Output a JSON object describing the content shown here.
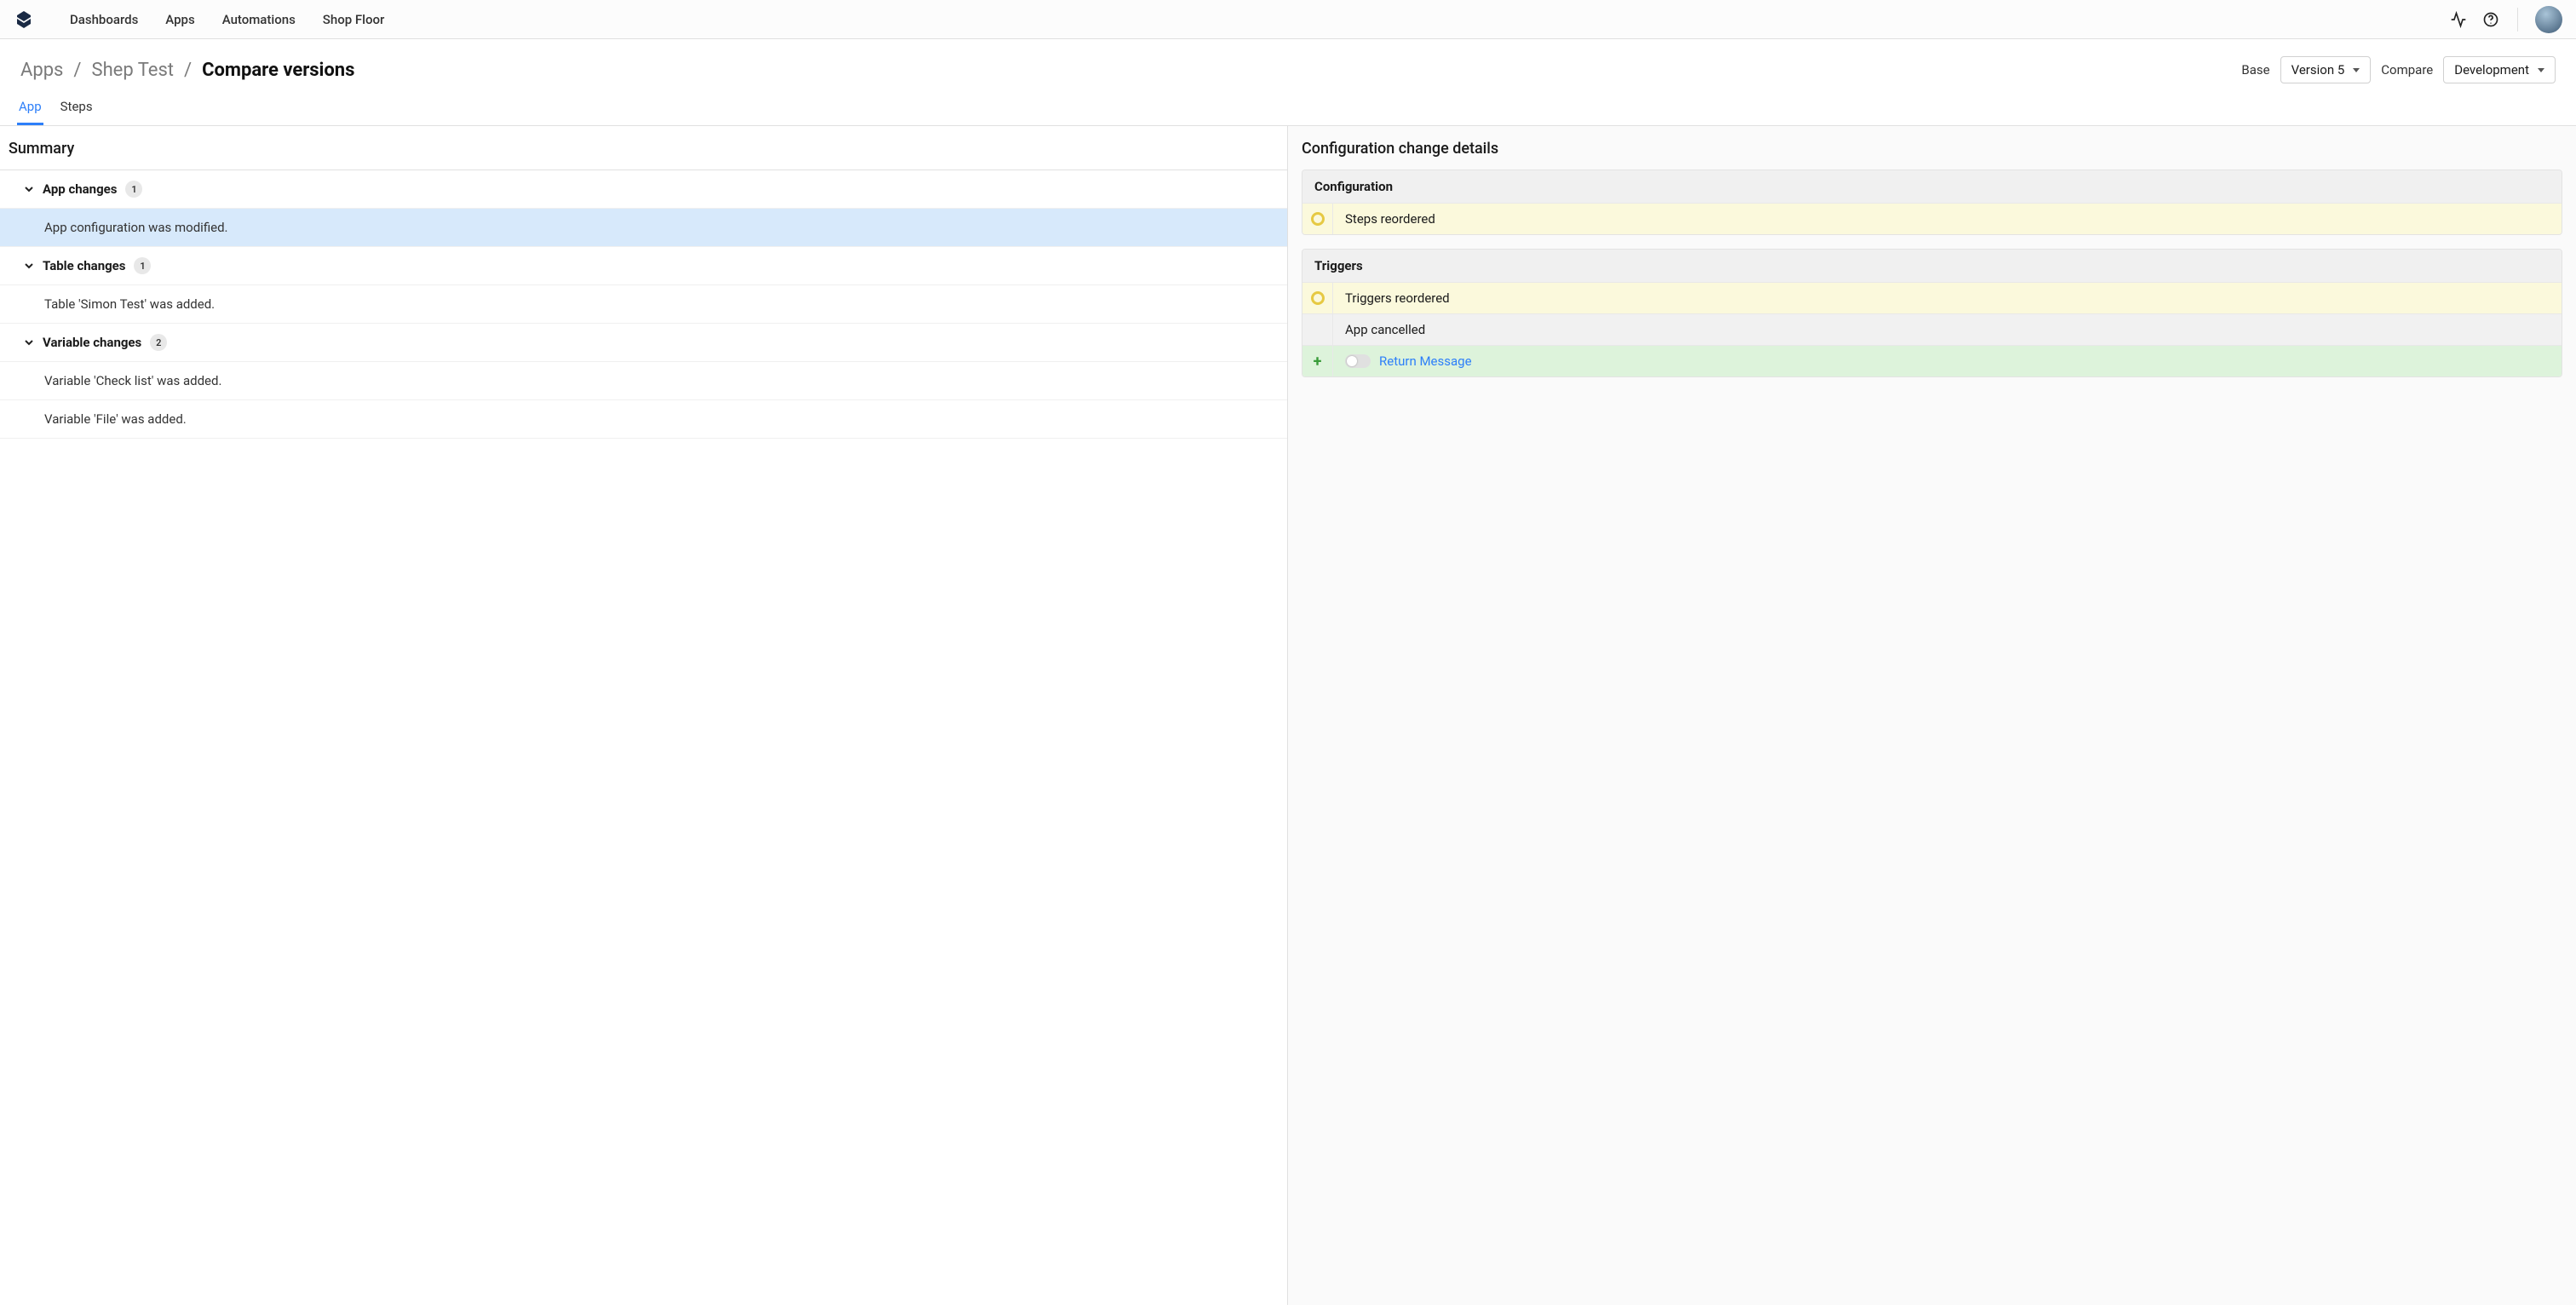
{
  "nav": {
    "dashboards": "Dashboards",
    "apps": "Apps",
    "automations": "Automations",
    "shopfloor": "Shop Floor"
  },
  "breadcrumb": {
    "apps": "Apps",
    "sep": "/",
    "app_name": "Shep Test",
    "current": "Compare versions"
  },
  "versions": {
    "base_label": "Base",
    "base_value": "Version 5",
    "compare_label": "Compare",
    "compare_value": "Development"
  },
  "tabs": {
    "app": "App",
    "steps": "Steps"
  },
  "left": {
    "title": "Summary",
    "groups": [
      {
        "header": "App changes",
        "count": "1",
        "items": [
          "App configuration was modified."
        ]
      },
      {
        "header": "Table changes",
        "count": "1",
        "items": [
          "Table 'Simon Test' was added."
        ]
      },
      {
        "header": "Variable changes",
        "count": "2",
        "items": [
          "Variable 'Check list' was added.",
          "Variable 'File' was added."
        ]
      }
    ]
  },
  "right": {
    "title": "Configuration change details",
    "sections": [
      {
        "head": "Configuration",
        "rows": [
          {
            "kind": "modified",
            "text": "Steps reordered"
          }
        ]
      },
      {
        "head": "Triggers",
        "rows": [
          {
            "kind": "modified",
            "text": "Triggers reordered"
          },
          {
            "kind": "neutral",
            "text": "App cancelled"
          },
          {
            "kind": "added",
            "text": "Return Message"
          }
        ]
      }
    ]
  }
}
